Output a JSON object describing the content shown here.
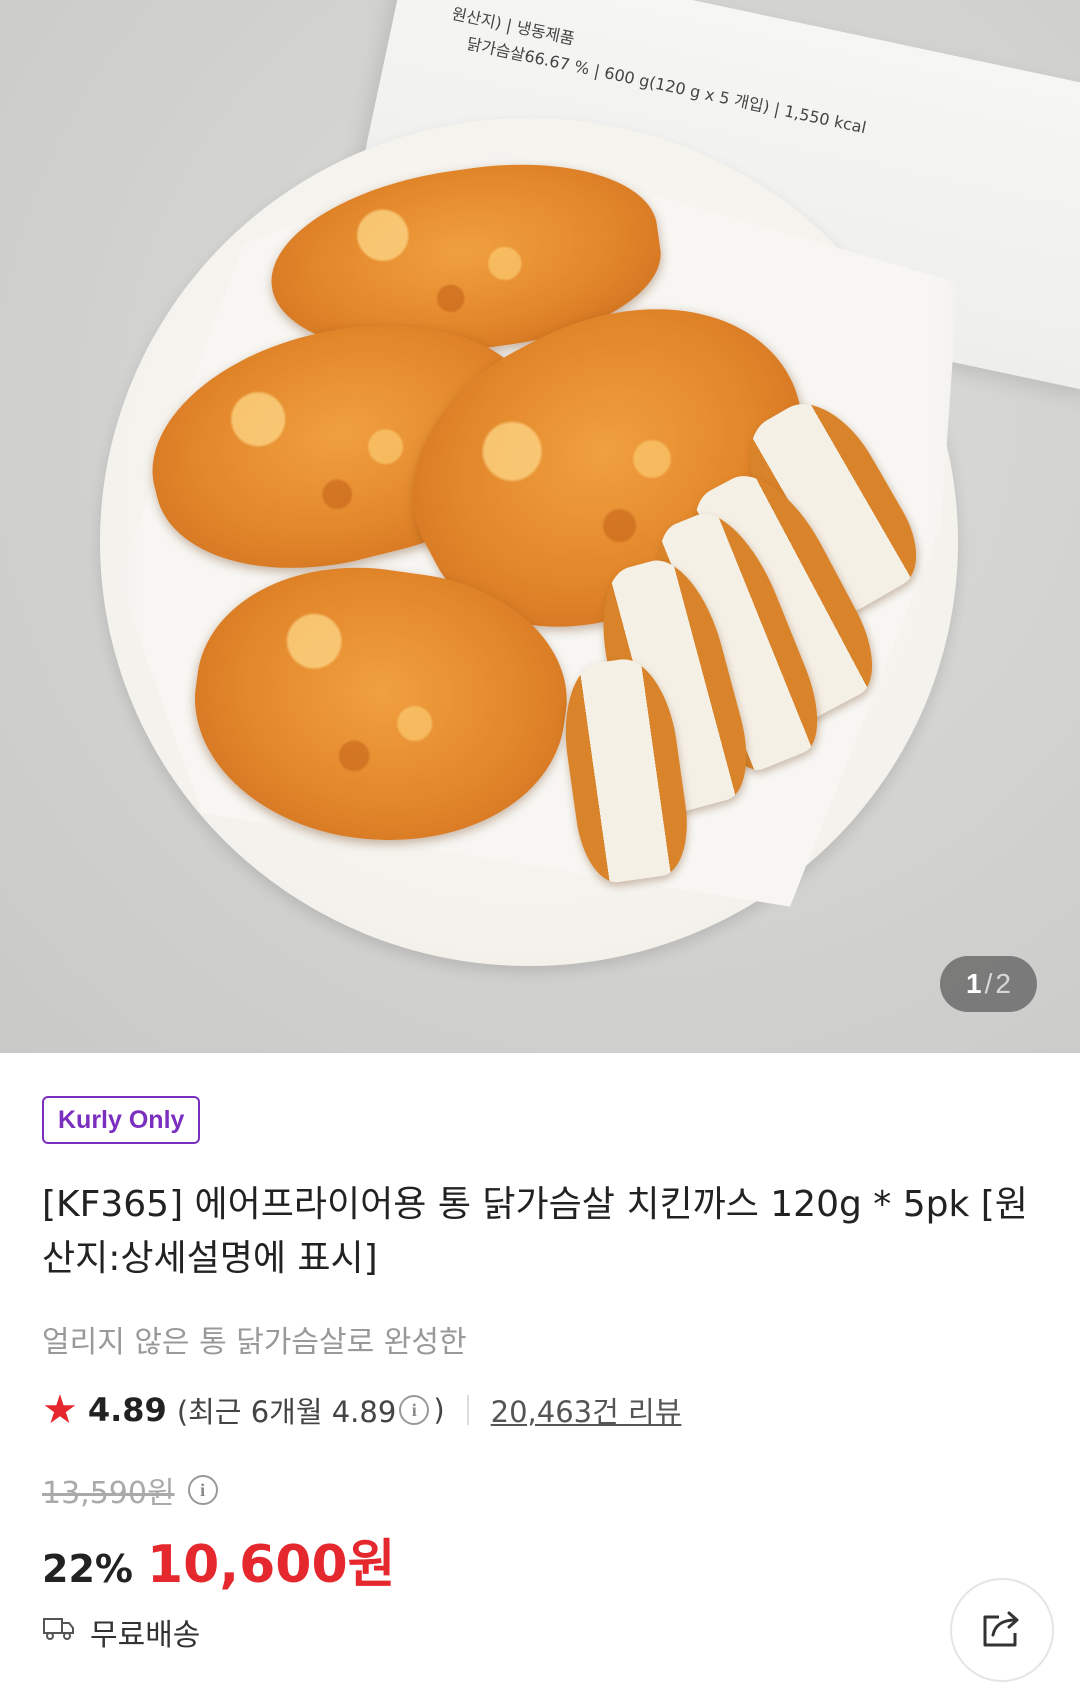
{
  "image": {
    "package_text_line1": "원산지) | 냉동제품",
    "package_text_line2": "닭가슴살66.67 % | 600 g(120 g x 5 개입) | 1,550 kcal",
    "counter": {
      "current": "1",
      "separator": "/",
      "total": "2"
    }
  },
  "product": {
    "badge": "Kurly Only",
    "title": "[KF365] 에어프라이어용 통 닭가슴살 치킨까스 120g * 5pk [원산지:상세설명에 표시]",
    "subtitle": "얼리지 않은 통 닭가슴살로 완성한",
    "rating": {
      "score": "4.89",
      "recent_prefix": "(최근 6개월 4.89",
      "recent_suffix": ")",
      "review_count": "20,463건 리뷰"
    },
    "original_price": "13,590원",
    "discount": "22%",
    "price": "10,600원",
    "delivery": "무료배송"
  },
  "colors": {
    "accent_red": "#e5282e",
    "kurly_purple": "#7b2fbf"
  }
}
